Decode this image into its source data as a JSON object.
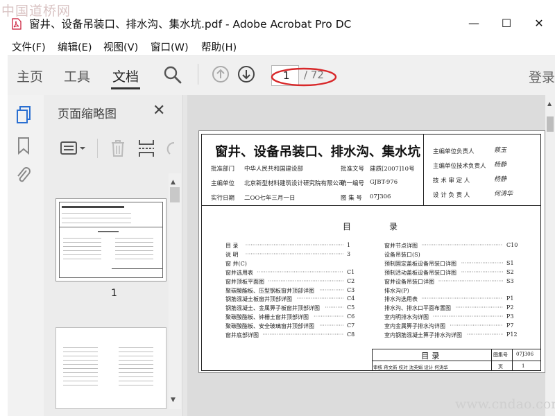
{
  "watermark_top": "中国道桥网",
  "watermark_bottom": "www.cndao.com",
  "window": {
    "title": "窗井、设备吊装口、排水沟、集水坑.pdf - Adobe Acrobat Pro DC",
    "minimize": "—",
    "maximize": "☐",
    "close": "✕"
  },
  "menu": [
    "文件(F)",
    "编辑(E)",
    "视图(V)",
    "窗口(W)",
    "帮助(H)"
  ],
  "toolbar": {
    "tabs": [
      "主页",
      "工具",
      "文档"
    ],
    "active_tab": "文档",
    "page_current": "1",
    "page_total": "/ 72",
    "login": "登录"
  },
  "thumb_panel": {
    "title": "页面缩略图",
    "close": "✕",
    "page1_label": "1"
  },
  "doc": {
    "title": "窗井、设备吊装口、排水沟、集水坑",
    "header_rows": [
      {
        "k1": "批准部门",
        "v1": "中华人民共和国建设部",
        "k2": "批准文号",
        "v2": "建质[2007]10号"
      },
      {
        "k1": "主编单位",
        "v1": "北京新型材料建筑设计研究院有限公司",
        "k2": "统一编号",
        "v2": "GJBT-976"
      },
      {
        "k1": "实行日期",
        "v1": "二OO七年三月一日",
        "k2": "图 集 号",
        "v2": "07J306"
      }
    ],
    "responsible": [
      {
        "label": "主编单位负责人",
        "sig": "蔡玉"
      },
      {
        "label": "主编单位技术负责人",
        "sig": "杨静"
      },
      {
        "label": "技 术 审 定 人",
        "sig": "杨静"
      },
      {
        "label": "设 计 负 责 人",
        "sig": "何涛华"
      }
    ],
    "toc_heading_a": "目",
    "toc_heading_b": "录",
    "toc_left": [
      {
        "t": "目 录",
        "p": "1"
      },
      {
        "t": "说 明",
        "p": "3"
      },
      {
        "t": "窗 井(C)",
        "p": ""
      },
      {
        "t": "窗井选用表",
        "p": "C1"
      },
      {
        "t": "窗井顶板平面图",
        "p": "C2"
      },
      {
        "t": "聚碳酸酯板、压型钢板窗井顶部详图",
        "p": "C3"
      },
      {
        "t": "钢筋混凝土板窗井顶部详图",
        "p": "C4"
      },
      {
        "t": "钢筋混凝土、金属箅子板窗井顶部详图",
        "p": "C5"
      },
      {
        "t": "聚碳酸酯板、钟栅土窗井顶部详图",
        "p": "C6"
      },
      {
        "t": "聚碳酸酯板、安全玻璃窗井顶部详图",
        "p": "C7"
      },
      {
        "t": "窗井底部详图",
        "p": "C8"
      }
    ],
    "toc_right": [
      {
        "t": "窗井节点详图",
        "p": "C10"
      },
      {
        "t": "设备吊装口(S)",
        "p": ""
      },
      {
        "t": "预制固定盖板设备吊装口详图",
        "p": "S1"
      },
      {
        "t": "预制活动盖板设备吊装口详图",
        "p": "S2"
      },
      {
        "t": "窗井设备吊装口详图",
        "p": "S3"
      },
      {
        "t": "排水沟(P)",
        "p": ""
      },
      {
        "t": "排水沟选用表",
        "p": "P1"
      },
      {
        "t": "排水沟、排水口平面布置图",
        "p": "P2"
      },
      {
        "t": "室内明排水沟详图",
        "p": "P3"
      },
      {
        "t": "室内金属箅子排水沟详图",
        "p": "P7"
      },
      {
        "t": "室内钢筋混凝土箅子排水沟详图",
        "p": "P12"
      }
    ],
    "stamp": {
      "title": "目  录",
      "atlas_label": "图集号",
      "atlas_value": "07J306",
      "page_label": "页",
      "page_value": "1",
      "roles": "审核 蒋文新  校对 沈英娟  设计 何涛华"
    }
  },
  "colors": {
    "accent_blue": "#2a6fd1",
    "red_ellipse": "#d8282a",
    "toolbar_bg": "#f0f0f0"
  }
}
